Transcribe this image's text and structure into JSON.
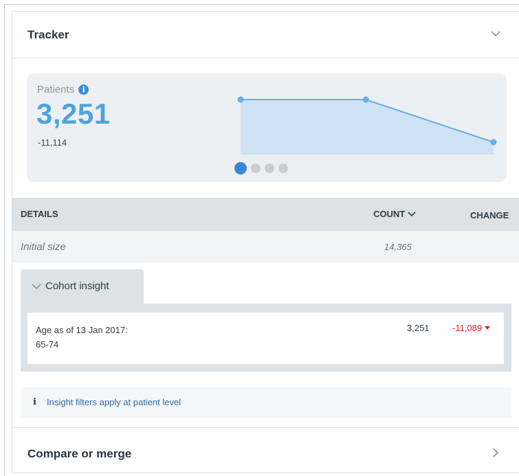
{
  "header": {
    "title": "Tracker",
    "toggle_icon": "chevron-down-icon"
  },
  "stats": {
    "label": "Patients",
    "value": "3,251",
    "delta": "-11,114",
    "carousel": {
      "total": 4,
      "active": 1
    },
    "sparkline": {
      "type": "area",
      "values": [
        14365,
        14365,
        3251
      ]
    },
    "colors": {
      "value": "#4fa3dc",
      "line": "#6aaee6",
      "fill": "#cfe2f4"
    }
  },
  "details": {
    "headers": {
      "details": "DETAILS",
      "count": "COUNT",
      "change": "CHANGE"
    },
    "initial_row": {
      "label": "Initial size",
      "count": "14,365"
    },
    "cohort_tab": {
      "label": "Cohort insight"
    },
    "insight_row": {
      "label_line1": "Age as of 13 Jan 2017:",
      "label_line2": "65-74",
      "count": "3,251",
      "change": "-11,089",
      "change_color": "#e0192b"
    },
    "note": {
      "icon": "info-icon",
      "text": "Insight filters apply at patient level"
    }
  },
  "footer": {
    "title": "Compare or merge",
    "icon": "chevron-right-icon"
  }
}
